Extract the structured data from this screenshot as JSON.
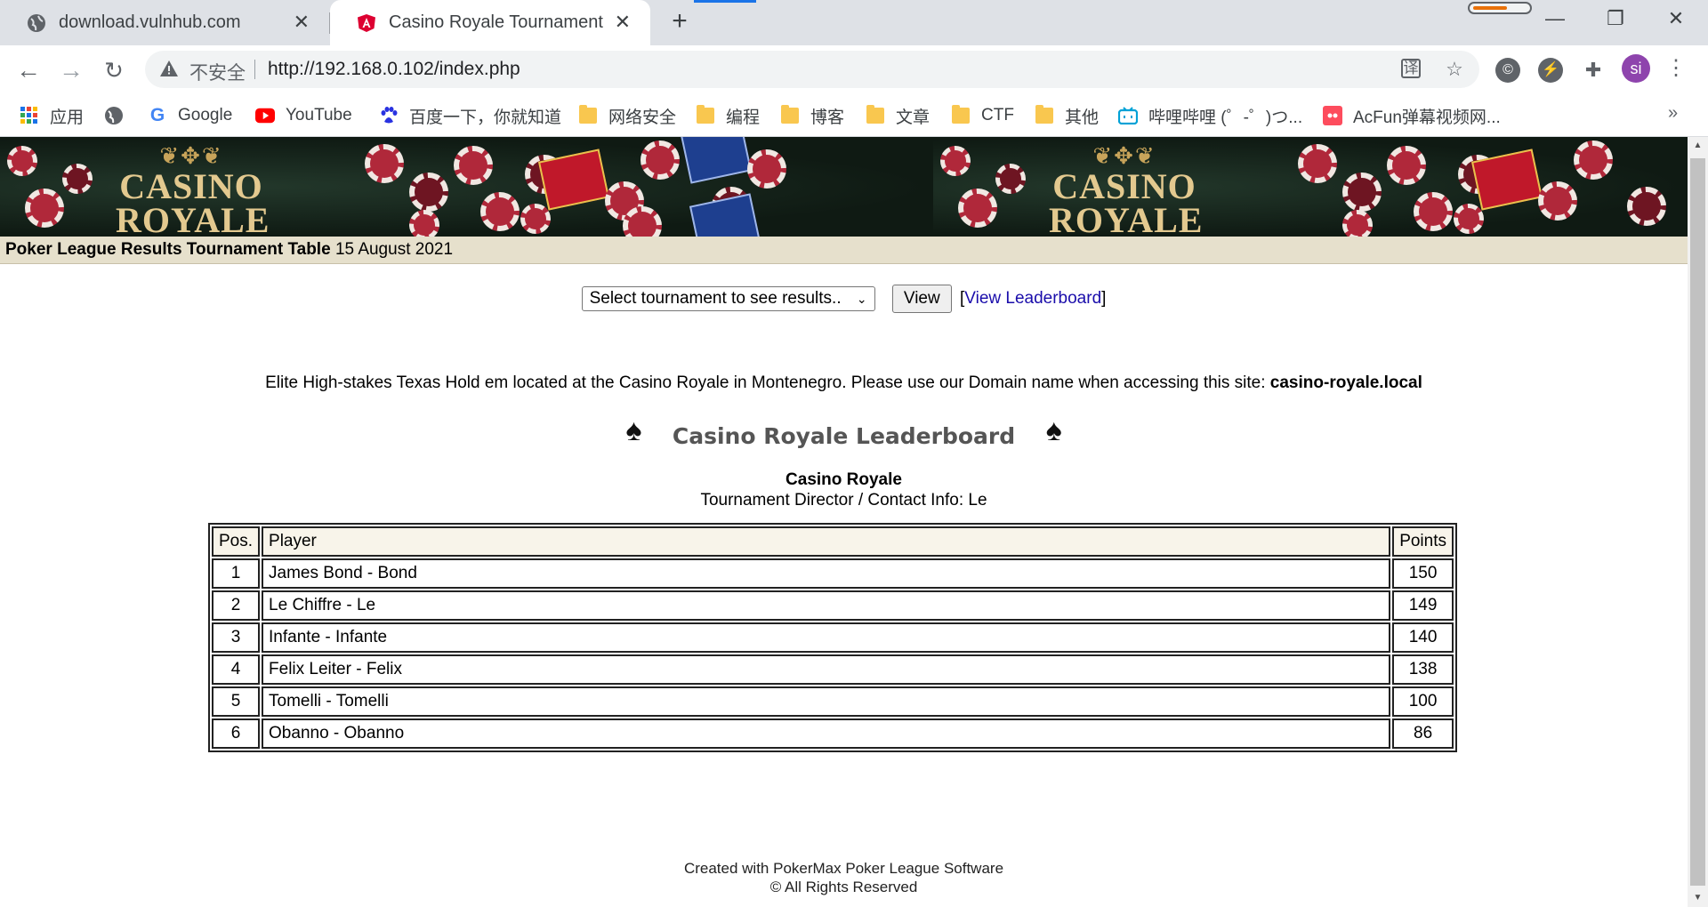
{
  "browser": {
    "tabs": [
      {
        "title": "download.vulnhub.com",
        "active": false,
        "icon": "globe-icon"
      },
      {
        "title": "Casino Royale Tournament",
        "active": true,
        "icon": "angular-shield-icon"
      }
    ],
    "omnibox": {
      "security_label": "不安全",
      "url": "http://192.168.0.102/index.php"
    },
    "avatar_initials": "si",
    "bookmarks": [
      {
        "label": "应用",
        "icon": "apps-grid-icon"
      },
      {
        "label": "",
        "icon": "globe-icon"
      },
      {
        "label": "Google",
        "icon": "google-icon"
      },
      {
        "label": "YouTube",
        "icon": "youtube-icon"
      },
      {
        "label": "百度一下，你就知道",
        "icon": "baidu-paw-icon"
      },
      {
        "label": "网络安全",
        "icon": "folder-icon"
      },
      {
        "label": "编程",
        "icon": "folder-icon"
      },
      {
        "label": "博客",
        "icon": "folder-icon"
      },
      {
        "label": "文章",
        "icon": "folder-icon"
      },
      {
        "label": "CTF",
        "icon": "folder-icon"
      },
      {
        "label": "其他",
        "icon": "folder-icon"
      },
      {
        "label": "哔哩哔哩 (゜-゜)つ...",
        "icon": "bilibili-icon"
      },
      {
        "label": "AcFun弹幕视频网...",
        "icon": "acfun-icon"
      }
    ]
  },
  "page": {
    "banner_logo": [
      "CASINO",
      "ROYALE"
    ],
    "title_bold": "Poker League Results Tournament Table",
    "title_date": "15 August 2021",
    "selector": {
      "selected": "Select tournament to see results..",
      "view_button": "View",
      "leaderboard_link": "View Leaderboard",
      "bracket_open": "[",
      "bracket_close": "]"
    },
    "intro_text": "Elite High-stakes Texas Hold em located at the Casino Royale in Montenegro. Please use our Domain name when accessing this site:",
    "intro_domain": "casino-royale.local",
    "leaderboard_title": "Casino Royale Leaderboard",
    "venue_name": "Casino Royale",
    "director": "Tournament Director / Contact Info: Le",
    "table": {
      "headers": {
        "pos": "Pos.",
        "player": "Player",
        "points": "Points"
      },
      "rows": [
        {
          "pos": "1",
          "player": "James Bond - Bond",
          "points": "150"
        },
        {
          "pos": "2",
          "player": "Le Chiffre - Le",
          "points": "149"
        },
        {
          "pos": "3",
          "player": "Infante - Infante",
          "points": "140"
        },
        {
          "pos": "4",
          "player": "Felix Leiter - Felix",
          "points": "138"
        },
        {
          "pos": "5",
          "player": "Tomelli - Tomelli",
          "points": "100"
        },
        {
          "pos": "6",
          "player": "Obanno - Obanno",
          "points": "86"
        }
      ]
    },
    "footer_line1": "Created with PokerMax Poker League Software",
    "footer_line2": "© All Rights Reserved"
  },
  "colors": {
    "title_bar_bg": "#e6e0cc",
    "link": "#1a0dab",
    "heading_grey": "#555555",
    "avatar": "#8e44ad"
  }
}
